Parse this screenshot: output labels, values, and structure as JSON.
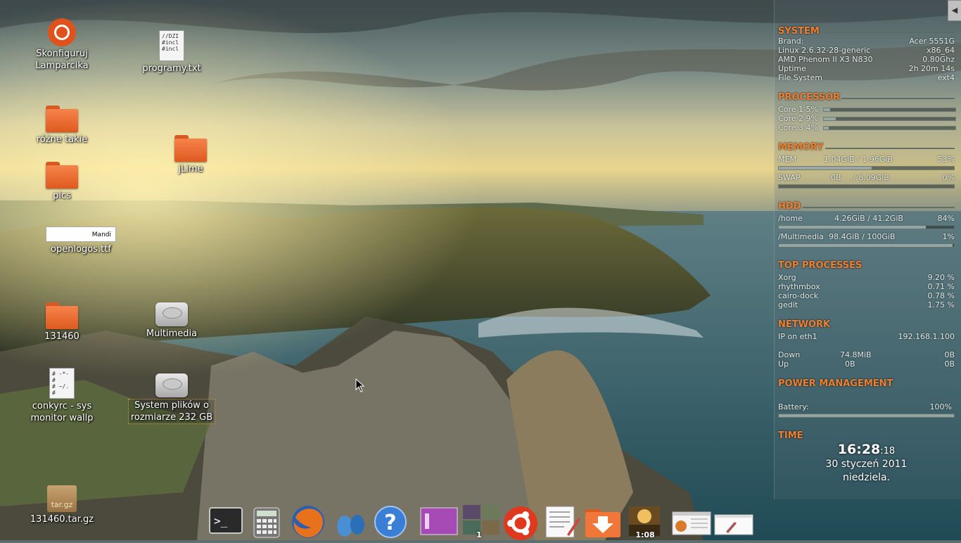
{
  "desktop": {
    "icons": {
      "lamparcik": "Skonfiguruj Lamparcika",
      "programy": "programy.txt",
      "programy_preview": [
        "//DZI",
        "",
        "#incl",
        "#incl"
      ],
      "rozne": "różne takie",
      "jlime": "jLime",
      "pics": "pics",
      "openlogos": "openlogos.ttf",
      "openlogos_preview": "Mandi",
      "f131460": "131460",
      "multimedia": "Multimedia",
      "conkyrc": "conkyrc - sys monitor wallp",
      "conkyrc_preview": [
        "# -*-",
        "#",
        "# ~/.",
        "#"
      ],
      "system_fs": "System plików o rozmiarze 232 GB",
      "tgz": "131460.tar.gz",
      "tgz_preview": "tar.gz"
    }
  },
  "conky": {
    "toggle": "◀",
    "system": {
      "title": "SYSTEM",
      "rows": [
        {
          "label": "Brand:",
          "value": "Acer 5551G"
        },
        {
          "label": "Linux 2.6.32-28-generic",
          "value": "x86_64"
        },
        {
          "label": "AMD Phenom II X3 N830",
          "value": "0.80Ghz"
        },
        {
          "label": "Uptime",
          "value": "2h 20m 14s"
        },
        {
          "label": "File System",
          "value": "ext4"
        }
      ]
    },
    "processor": {
      "title": "PROCESSOR",
      "cores": [
        {
          "label": "Core 1  5%",
          "pct": 5
        },
        {
          "label": "Core 2  9%",
          "pct": 9
        },
        {
          "label": "Core 3  4%",
          "pct": 4
        }
      ]
    },
    "memory": {
      "title": "MEMORY",
      "mem": {
        "label": "MEM",
        "used": "1.04GiB / 1.96GiB",
        "pct_text": "53%",
        "pct": 53
      },
      "swap": {
        "label": "SWAP",
        "used": "0B     / 8.09GiB",
        "pct_text": "0%",
        "pct": 0
      }
    },
    "hdd": {
      "title": "HDD",
      "home": {
        "label": "/home",
        "used": "4.26GiB / 41.2GiB",
        "pct_text": "84%",
        "pct": 84
      },
      "multimedia": {
        "label": "/Multimedia",
        "used": "98.4GiB / 100GiB",
        "pct_text": "1%",
        "pct": 99
      }
    },
    "top": {
      "title": "TOP PROCESSES",
      "procs": [
        {
          "name": "Xorg",
          "pct": "9.20 %"
        },
        {
          "name": "rhythmbox",
          "pct": "0.71 %"
        },
        {
          "name": "cairo-dock",
          "pct": "0.78 %"
        },
        {
          "name": "gedit",
          "pct": "1.75 %"
        }
      ]
    },
    "network": {
      "title": "NETWORK",
      "ip_label": "IP on eth1",
      "ip": "192.168.1.100",
      "down_label": "Down",
      "down_total": "74.8MiB",
      "down_rate": "0B",
      "up_label": "Up",
      "up_total": "0B",
      "up_rate": "0B"
    },
    "power": {
      "title": "POWER MANAGEMENT",
      "battery_label": "Battery:",
      "battery_text": "100%",
      "battery_pct": 100
    },
    "time": {
      "title": "TIME",
      "hm": "16:28",
      "sec": ":18",
      "date": "30 styczeń 2011",
      "day": "niedziela."
    }
  },
  "dock": {
    "workspace_badge": "1",
    "music_time": "1:08",
    "help_glyph": "?",
    "terminal_glyph": ">_"
  }
}
